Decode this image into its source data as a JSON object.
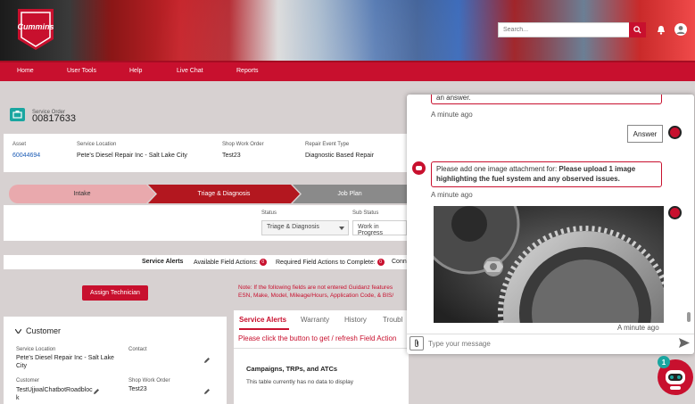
{
  "brand": {
    "logo_text": "Cummins"
  },
  "header": {
    "search_placeholder": "Search..."
  },
  "nav": {
    "items": [
      "Home",
      "User Tools",
      "Help",
      "Live Chat",
      "Reports"
    ]
  },
  "service_order": {
    "label": "Service Order",
    "number": "00817633",
    "fields": [
      {
        "label": "Asset",
        "value": "60044694"
      },
      {
        "label": "Service Location",
        "value": "Pete's Diesel Repair Inc - Salt Lake City"
      },
      {
        "label": "Shop Work Order",
        "value": "Test23"
      },
      {
        "label": "Repair Event Type",
        "value": "Diagnostic Based Repair"
      }
    ]
  },
  "path": {
    "steps": [
      "Intake",
      "Triage & Diagnosis",
      "Job Plan"
    ]
  },
  "status": {
    "status_label": "Status",
    "status_value": "Triage & Diagnosis",
    "sub_label": "Sub Status",
    "sub_value": "Work in Progress"
  },
  "alerts_bar": {
    "title": "Service Alerts",
    "available": "Available Field Actions:",
    "available_count": "0",
    "required": "Required Field Actions to Complete:",
    "required_count": "0",
    "more": "Conn"
  },
  "assign_button": "Assign Technician",
  "note": {
    "line1": "Note: If the following fields are not entered Guidanz features",
    "line2": "ESN, Make, Model, Mileage/Hours, Application Code, & BIS/"
  },
  "customer": {
    "title": "Customer",
    "service_location_label": "Service Location",
    "service_location_value": "Pete's Diesel Repair Inc - Salt Lake City",
    "contact_label": "Contact",
    "customer_label": "Customer",
    "customer_value": "TestUjjwalChatbotRoadblock",
    "shop_wo_label": "Shop Work Order",
    "shop_wo_value": "Test23"
  },
  "tabs": {
    "items": [
      "Service Alerts",
      "Warranty",
      "History",
      "Troubl"
    ]
  },
  "field_action_msg": "Please click the button to get / refresh Field Action",
  "campaigns": {
    "title": "Campaigns, TRPs, and ATCs",
    "empty": "This table currently has no data to display"
  },
  "chat": {
    "top_bubble": "an answer.",
    "top_time": "A minute ago",
    "answer_bubble": "Answer",
    "bot_message_prefix": "Please add one image attachment for: ",
    "bot_message_bold": "Please upload 1 image highlighting the fuel system and any observed issues.",
    "bot_time": "A minute ago",
    "image_time": "A minute ago",
    "input_placeholder": "Type your message",
    "badge": "1"
  },
  "colors": {
    "brand_red": "#c8102e",
    "teal": "#1aa6a0"
  }
}
